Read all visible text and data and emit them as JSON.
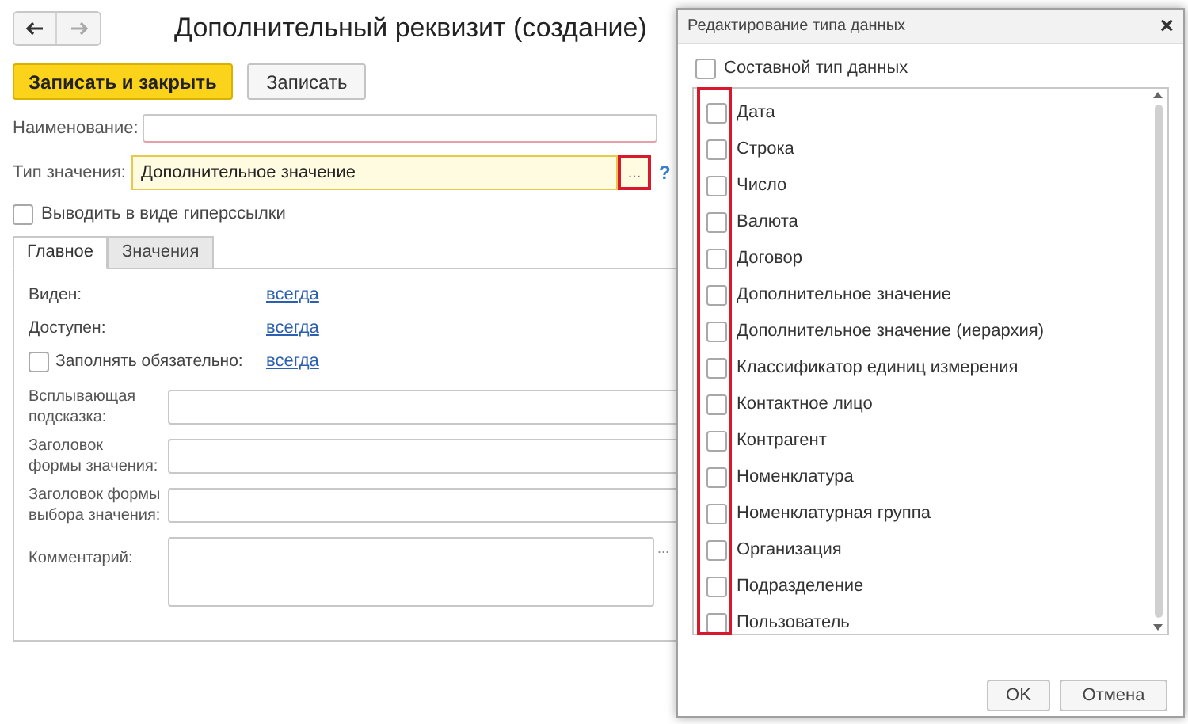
{
  "window": {
    "title": "Дополнительный реквизит (создание)"
  },
  "toolbar": [
    {
      "label": "Записать и закрыть",
      "kind": "primary"
    },
    {
      "label": "Записать",
      "kind": "normal"
    }
  ],
  "name_field": {
    "label": "Наименование:"
  },
  "value_type": {
    "label": "Тип значения:",
    "value": "Дополнительное значение",
    "select_button": "...",
    "help": "?"
  },
  "hyperlink_option": {
    "label": "Выводить в виде гиперссылки",
    "checked": false
  },
  "tabs": [
    {
      "label": "Главное",
      "selected": true
    },
    {
      "label": "Значения",
      "selected": false
    }
  ],
  "settings": [
    {
      "kind": "link",
      "label": "Виден:",
      "link": "всегда"
    },
    {
      "kind": "link",
      "label": "Доступен:",
      "link": "всегда"
    },
    {
      "kind": "check_link",
      "label": "Заполнять обязательно:",
      "checked": false,
      "link": "всегда"
    }
  ],
  "text_fields": [
    {
      "kind": "line",
      "label": "Всплывающая\nподсказка:"
    },
    {
      "kind": "line",
      "label": "Заголовок\nформы значения:"
    },
    {
      "kind": "line",
      "label": "Заголовок формы\nвыбора значения:"
    },
    {
      "kind": "multiline",
      "label": "Комментарий:",
      "select_button": "..."
    }
  ],
  "dialog": {
    "title": "Редактирование типа данных",
    "close": "×",
    "composite": {
      "label": "Составной тип данных",
      "checked": false
    },
    "types": [
      {
        "label": "Дата",
        "checked": false
      },
      {
        "label": "Строка",
        "checked": false
      },
      {
        "label": "Число",
        "checked": false
      },
      {
        "label": "Валюта",
        "checked": false
      },
      {
        "label": "Договор",
        "checked": false
      },
      {
        "label": "Дополнительное значение",
        "checked": false
      },
      {
        "label": "Дополнительное значение (иерархия)",
        "checked": false
      },
      {
        "label": "Классификатор единиц измерения",
        "checked": false
      },
      {
        "label": "Контактное лицо",
        "checked": false
      },
      {
        "label": "Контрагент",
        "checked": false
      },
      {
        "label": "Номенклатура",
        "checked": false
      },
      {
        "label": "Номенклатурная группа",
        "checked": false
      },
      {
        "label": "Организация",
        "checked": false
      },
      {
        "label": "Подразделение",
        "checked": false
      },
      {
        "label": "Пользователь",
        "checked": false
      }
    ],
    "buttons": [
      "OK",
      "Отмена"
    ]
  }
}
